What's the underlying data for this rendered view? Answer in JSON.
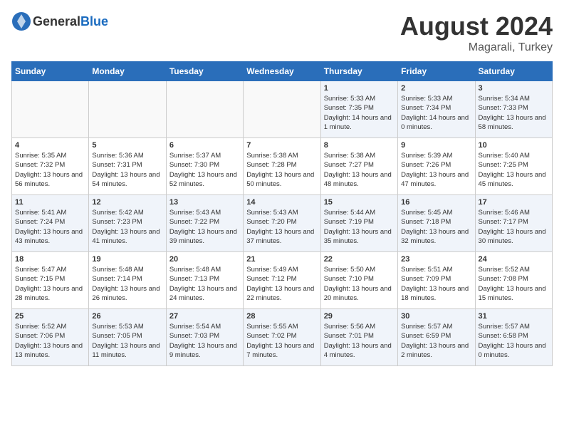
{
  "header": {
    "logo_general": "General",
    "logo_blue": "Blue",
    "month_year": "August 2024",
    "location": "Magarali, Turkey"
  },
  "days_of_week": [
    "Sunday",
    "Monday",
    "Tuesday",
    "Wednesday",
    "Thursday",
    "Friday",
    "Saturday"
  ],
  "weeks": [
    [
      {
        "day": "",
        "sunrise": "",
        "sunset": "",
        "daylight": ""
      },
      {
        "day": "",
        "sunrise": "",
        "sunset": "",
        "daylight": ""
      },
      {
        "day": "",
        "sunrise": "",
        "sunset": "",
        "daylight": ""
      },
      {
        "day": "",
        "sunrise": "",
        "sunset": "",
        "daylight": ""
      },
      {
        "day": "1",
        "sunrise": "Sunrise: 5:33 AM",
        "sunset": "Sunset: 7:35 PM",
        "daylight": "Daylight: 14 hours and 1 minute."
      },
      {
        "day": "2",
        "sunrise": "Sunrise: 5:33 AM",
        "sunset": "Sunset: 7:34 PM",
        "daylight": "Daylight: 14 hours and 0 minutes."
      },
      {
        "day": "3",
        "sunrise": "Sunrise: 5:34 AM",
        "sunset": "Sunset: 7:33 PM",
        "daylight": "Daylight: 13 hours and 58 minutes."
      }
    ],
    [
      {
        "day": "4",
        "sunrise": "Sunrise: 5:35 AM",
        "sunset": "Sunset: 7:32 PM",
        "daylight": "Daylight: 13 hours and 56 minutes."
      },
      {
        "day": "5",
        "sunrise": "Sunrise: 5:36 AM",
        "sunset": "Sunset: 7:31 PM",
        "daylight": "Daylight: 13 hours and 54 minutes."
      },
      {
        "day": "6",
        "sunrise": "Sunrise: 5:37 AM",
        "sunset": "Sunset: 7:30 PM",
        "daylight": "Daylight: 13 hours and 52 minutes."
      },
      {
        "day": "7",
        "sunrise": "Sunrise: 5:38 AM",
        "sunset": "Sunset: 7:28 PM",
        "daylight": "Daylight: 13 hours and 50 minutes."
      },
      {
        "day": "8",
        "sunrise": "Sunrise: 5:38 AM",
        "sunset": "Sunset: 7:27 PM",
        "daylight": "Daylight: 13 hours and 48 minutes."
      },
      {
        "day": "9",
        "sunrise": "Sunrise: 5:39 AM",
        "sunset": "Sunset: 7:26 PM",
        "daylight": "Daylight: 13 hours and 47 minutes."
      },
      {
        "day": "10",
        "sunrise": "Sunrise: 5:40 AM",
        "sunset": "Sunset: 7:25 PM",
        "daylight": "Daylight: 13 hours and 45 minutes."
      }
    ],
    [
      {
        "day": "11",
        "sunrise": "Sunrise: 5:41 AM",
        "sunset": "Sunset: 7:24 PM",
        "daylight": "Daylight: 13 hours and 43 minutes."
      },
      {
        "day": "12",
        "sunrise": "Sunrise: 5:42 AM",
        "sunset": "Sunset: 7:23 PM",
        "daylight": "Daylight: 13 hours and 41 minutes."
      },
      {
        "day": "13",
        "sunrise": "Sunrise: 5:43 AM",
        "sunset": "Sunset: 7:22 PM",
        "daylight": "Daylight: 13 hours and 39 minutes."
      },
      {
        "day": "14",
        "sunrise": "Sunrise: 5:43 AM",
        "sunset": "Sunset: 7:20 PM",
        "daylight": "Daylight: 13 hours and 37 minutes."
      },
      {
        "day": "15",
        "sunrise": "Sunrise: 5:44 AM",
        "sunset": "Sunset: 7:19 PM",
        "daylight": "Daylight: 13 hours and 35 minutes."
      },
      {
        "day": "16",
        "sunrise": "Sunrise: 5:45 AM",
        "sunset": "Sunset: 7:18 PM",
        "daylight": "Daylight: 13 hours and 32 minutes."
      },
      {
        "day": "17",
        "sunrise": "Sunrise: 5:46 AM",
        "sunset": "Sunset: 7:17 PM",
        "daylight": "Daylight: 13 hours and 30 minutes."
      }
    ],
    [
      {
        "day": "18",
        "sunrise": "Sunrise: 5:47 AM",
        "sunset": "Sunset: 7:15 PM",
        "daylight": "Daylight: 13 hours and 28 minutes."
      },
      {
        "day": "19",
        "sunrise": "Sunrise: 5:48 AM",
        "sunset": "Sunset: 7:14 PM",
        "daylight": "Daylight: 13 hours and 26 minutes."
      },
      {
        "day": "20",
        "sunrise": "Sunrise: 5:48 AM",
        "sunset": "Sunset: 7:13 PM",
        "daylight": "Daylight: 13 hours and 24 minutes."
      },
      {
        "day": "21",
        "sunrise": "Sunrise: 5:49 AM",
        "sunset": "Sunset: 7:12 PM",
        "daylight": "Daylight: 13 hours and 22 minutes."
      },
      {
        "day": "22",
        "sunrise": "Sunrise: 5:50 AM",
        "sunset": "Sunset: 7:10 PM",
        "daylight": "Daylight: 13 hours and 20 minutes."
      },
      {
        "day": "23",
        "sunrise": "Sunrise: 5:51 AM",
        "sunset": "Sunset: 7:09 PM",
        "daylight": "Daylight: 13 hours and 18 minutes."
      },
      {
        "day": "24",
        "sunrise": "Sunrise: 5:52 AM",
        "sunset": "Sunset: 7:08 PM",
        "daylight": "Daylight: 13 hours and 15 minutes."
      }
    ],
    [
      {
        "day": "25",
        "sunrise": "Sunrise: 5:52 AM",
        "sunset": "Sunset: 7:06 PM",
        "daylight": "Daylight: 13 hours and 13 minutes."
      },
      {
        "day": "26",
        "sunrise": "Sunrise: 5:53 AM",
        "sunset": "Sunset: 7:05 PM",
        "daylight": "Daylight: 13 hours and 11 minutes."
      },
      {
        "day": "27",
        "sunrise": "Sunrise: 5:54 AM",
        "sunset": "Sunset: 7:03 PM",
        "daylight": "Daylight: 13 hours and 9 minutes."
      },
      {
        "day": "28",
        "sunrise": "Sunrise: 5:55 AM",
        "sunset": "Sunset: 7:02 PM",
        "daylight": "Daylight: 13 hours and 7 minutes."
      },
      {
        "day": "29",
        "sunrise": "Sunrise: 5:56 AM",
        "sunset": "Sunset: 7:01 PM",
        "daylight": "Daylight: 13 hours and 4 minutes."
      },
      {
        "day": "30",
        "sunrise": "Sunrise: 5:57 AM",
        "sunset": "Sunset: 6:59 PM",
        "daylight": "Daylight: 13 hours and 2 minutes."
      },
      {
        "day": "31",
        "sunrise": "Sunrise: 5:57 AM",
        "sunset": "Sunset: 6:58 PM",
        "daylight": "Daylight: 13 hours and 0 minutes."
      }
    ]
  ]
}
